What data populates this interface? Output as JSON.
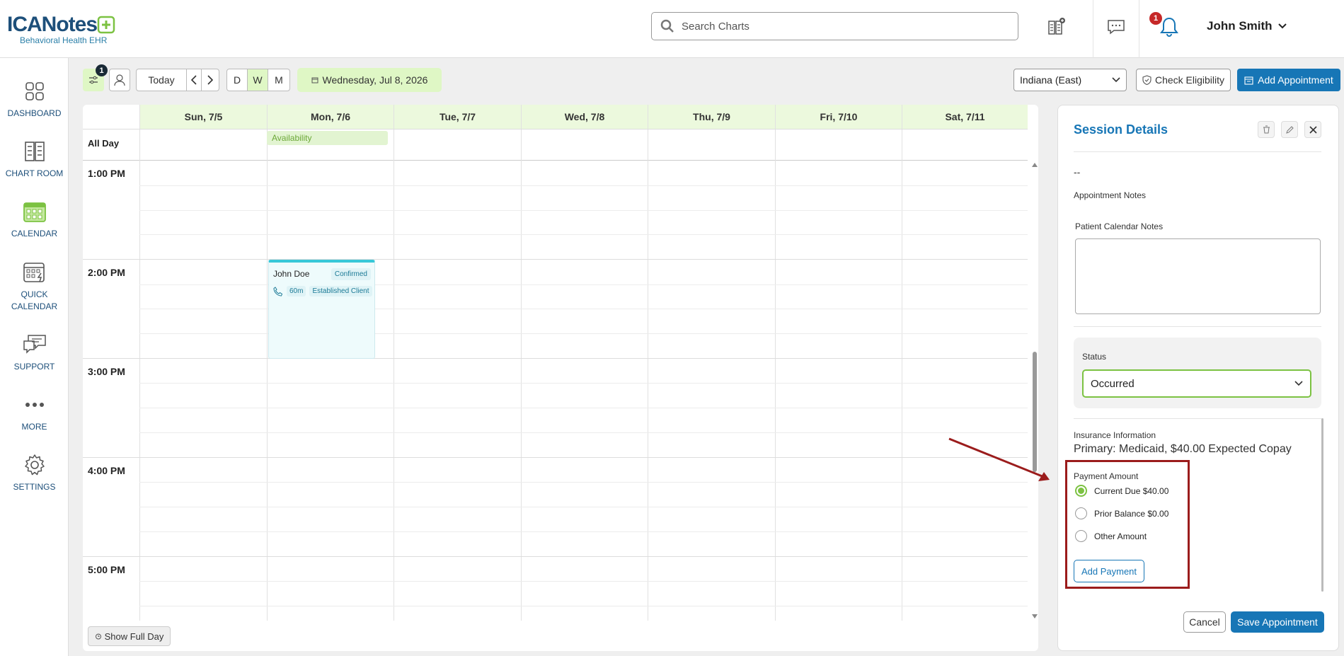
{
  "header": {
    "logo_main": "ICANotes",
    "logo_sub": "Behavioral Health EHR",
    "search_placeholder": "Search Charts",
    "notification_count": "1",
    "user_name": "John Smith"
  },
  "sidebar": {
    "items": [
      {
        "label": "DASHBOARD",
        "icon": "dashboard-icon"
      },
      {
        "label": "CHART ROOM",
        "icon": "chart-room-icon"
      },
      {
        "label": "CALENDAR",
        "icon": "calendar-icon"
      },
      {
        "label": "QUICK CALENDAR",
        "icon": "quick-calendar-icon"
      },
      {
        "label": "SUPPORT",
        "icon": "support-icon"
      },
      {
        "label": "MORE",
        "icon": "more-icon"
      },
      {
        "label": "SETTINGS",
        "icon": "gear-icon"
      }
    ]
  },
  "toolbar": {
    "filter_badge": "1",
    "today": "Today",
    "view_d": "D",
    "view_w": "W",
    "view_m": "M",
    "current_date": "Wednesday, Jul 8, 2026",
    "timezone": "Indiana (East)",
    "check_eligibility": "Check Eligibility",
    "add_appointment": "Add Appointment"
  },
  "calendar": {
    "days": [
      "Sun, 7/5",
      "Mon, 7/6",
      "Tue, 7/7",
      "Wed, 7/8",
      "Thu, 7/9",
      "Fri, 7/10",
      "Sat, 7/11"
    ],
    "all_day_label": "All Day",
    "availability_label": "Availability",
    "times": [
      "1:00 PM",
      "2:00 PM",
      "3:00 PM",
      "4:00 PM",
      "5:00 PM"
    ],
    "appointment": {
      "name": "John Doe",
      "status": "Confirmed",
      "duration": "60m",
      "type": "Established Client"
    },
    "show_full_day": "Show Full Day"
  },
  "session": {
    "title": "Session Details",
    "placeholder_dash": "--",
    "appointment_notes_label": "Appointment Notes",
    "patient_calendar_notes_label": "Patient Calendar Notes",
    "status_label": "Status",
    "status_value": "Occurred",
    "insurance_label": "Insurance Information",
    "insurance_value": "Primary: Medicaid, $40.00 Expected Copay",
    "payment_label": "Payment Amount",
    "payment_options": [
      "Current Due $40.00",
      "Prior Balance $0.00",
      "Other Amount"
    ],
    "add_payment": "Add Payment",
    "cancel": "Cancel",
    "save": "Save Appointment"
  },
  "colors": {
    "brand_blue": "#1776b6",
    "accent_green": "#7cc242",
    "highlight_red": "#9b1c1c"
  }
}
